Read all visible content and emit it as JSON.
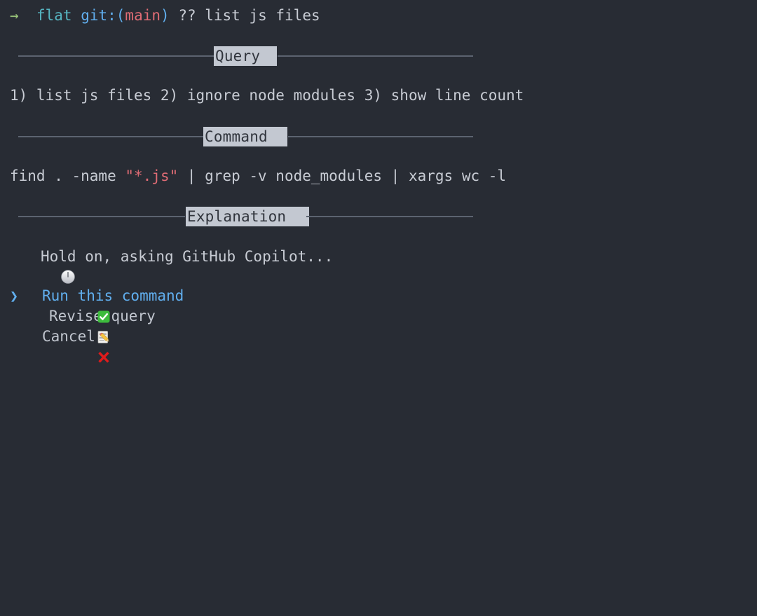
{
  "terminal": {
    "background_color": "#282c34",
    "foreground_color": "#c8ccd4"
  },
  "prompt": {
    "arrow": "→",
    "arrow_color": "#98c379",
    "directory": "flat",
    "directory_color": "#56b6c2",
    "git_keyword": "git:",
    "git_keyword_color": "#61afef",
    "paren_open": "(",
    "branch": "main",
    "branch_color": "#e06c75",
    "paren_close": ")",
    "command_invocation": "?? list js files"
  },
  "sections": [
    {
      "label": "Query",
      "body": "1) list js files 2) ignore node modules 3) show line count"
    },
    {
      "label": "Command",
      "body_before": "find . -name ",
      "body_string": "\"*.js\"",
      "body_after": " | grep -v node_modules | xargs wc -l",
      "string_color": "#e06c75"
    },
    {
      "label": "Explanation",
      "body": ""
    }
  ],
  "status": {
    "icon": "clock-twelve-oclock-emoji",
    "text": "Hold on, asking GitHub Copilot..."
  },
  "menu": {
    "pointer": "❯",
    "pointer_color": "#61afef",
    "selected_index": 0,
    "items": [
      {
        "icon": "white-heavy-check-mark-emoji",
        "label": "Run this command",
        "selected": true,
        "label_color": "#61afef"
      },
      {
        "icon": "memo-emoji",
        "label": "Revise query",
        "selected": false,
        "label_color": "#c0c5ce"
      },
      {
        "icon": "cross-mark-emoji",
        "label": "Cancel",
        "selected": false,
        "label_color": "#c0c5ce"
      }
    ]
  }
}
